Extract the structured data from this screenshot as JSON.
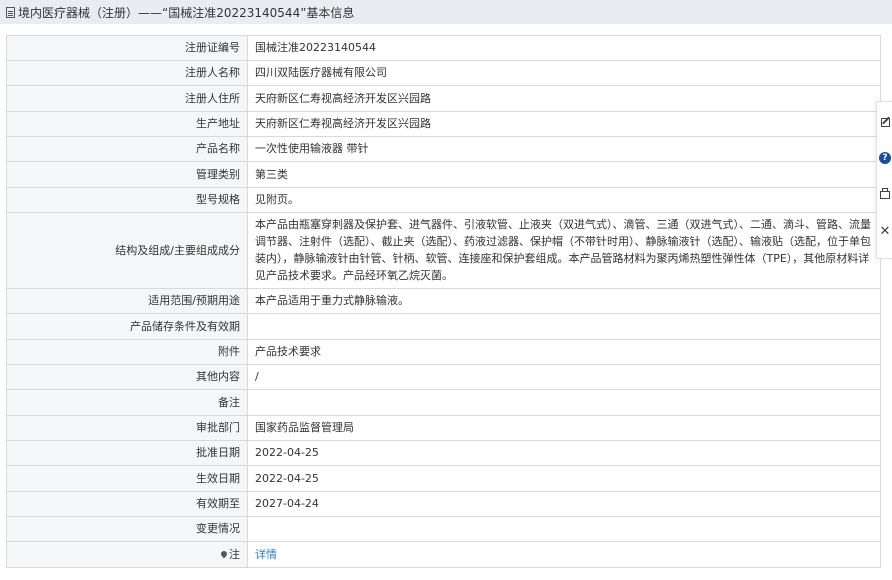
{
  "header": {
    "title": "境内医疗器械（注册）——“国械注准20223140544”基本信息"
  },
  "rows": [
    {
      "label": "注册证编号",
      "value": "国械注准20223140544"
    },
    {
      "label": "注册人名称",
      "value": "四川双陆医疗器械有限公司"
    },
    {
      "label": "注册人住所",
      "value": "天府新区仁寿视高经济开发区兴园路"
    },
    {
      "label": "生产地址",
      "value": "天府新区仁寿视高经济开发区兴园路"
    },
    {
      "label": "产品名称",
      "value": "一次性使用输液器 带针"
    },
    {
      "label": "管理类别",
      "value": "第三类"
    },
    {
      "label": "型号规格",
      "value": "见附页。"
    },
    {
      "label": "结构及组成/主要组成成分",
      "value": "本产品由瓶塞穿刺器及保护套、进气器件、引液软管、止液夹（双进气式）、滴管、三通（双进气式）、二通、滴斗、管路、流量调节器、注射件（选配）、截止夹（选配）、药液过滤器、保护帽（不带针时用）、静脉输液针（选配）、输液贴（选配，位于单包装内），静脉输液针由针管、针柄、软管、连接座和保护套组成。本产品管路材料为聚丙烯热塑性弹性体（TPE），其他原材料详见产品技术要求。产品经环氧乙烷灭菌。"
    },
    {
      "label": "适用范围/预期用途",
      "value": "本产品适用于重力式静脉输液。"
    },
    {
      "label": "产品储存条件及有效期",
      "value": ""
    },
    {
      "label": "附件",
      "value": "产品技术要求"
    },
    {
      "label": "其他内容",
      "value": "/"
    },
    {
      "label": "备注",
      "value": ""
    },
    {
      "label": "审批部门",
      "value": "国家药品监督管理局"
    },
    {
      "label": "批准日期",
      "value": "2022-04-25"
    },
    {
      "label": "生效日期",
      "value": "2022-04-25"
    },
    {
      "label": "有效期至",
      "value": "2027-04-24"
    },
    {
      "label": "变更情况",
      "value": ""
    }
  ],
  "note_row": {
    "label": "注",
    "link": "详情"
  },
  "sidebar": {
    "help_glyph": "?",
    "close_glyph": "✕"
  }
}
